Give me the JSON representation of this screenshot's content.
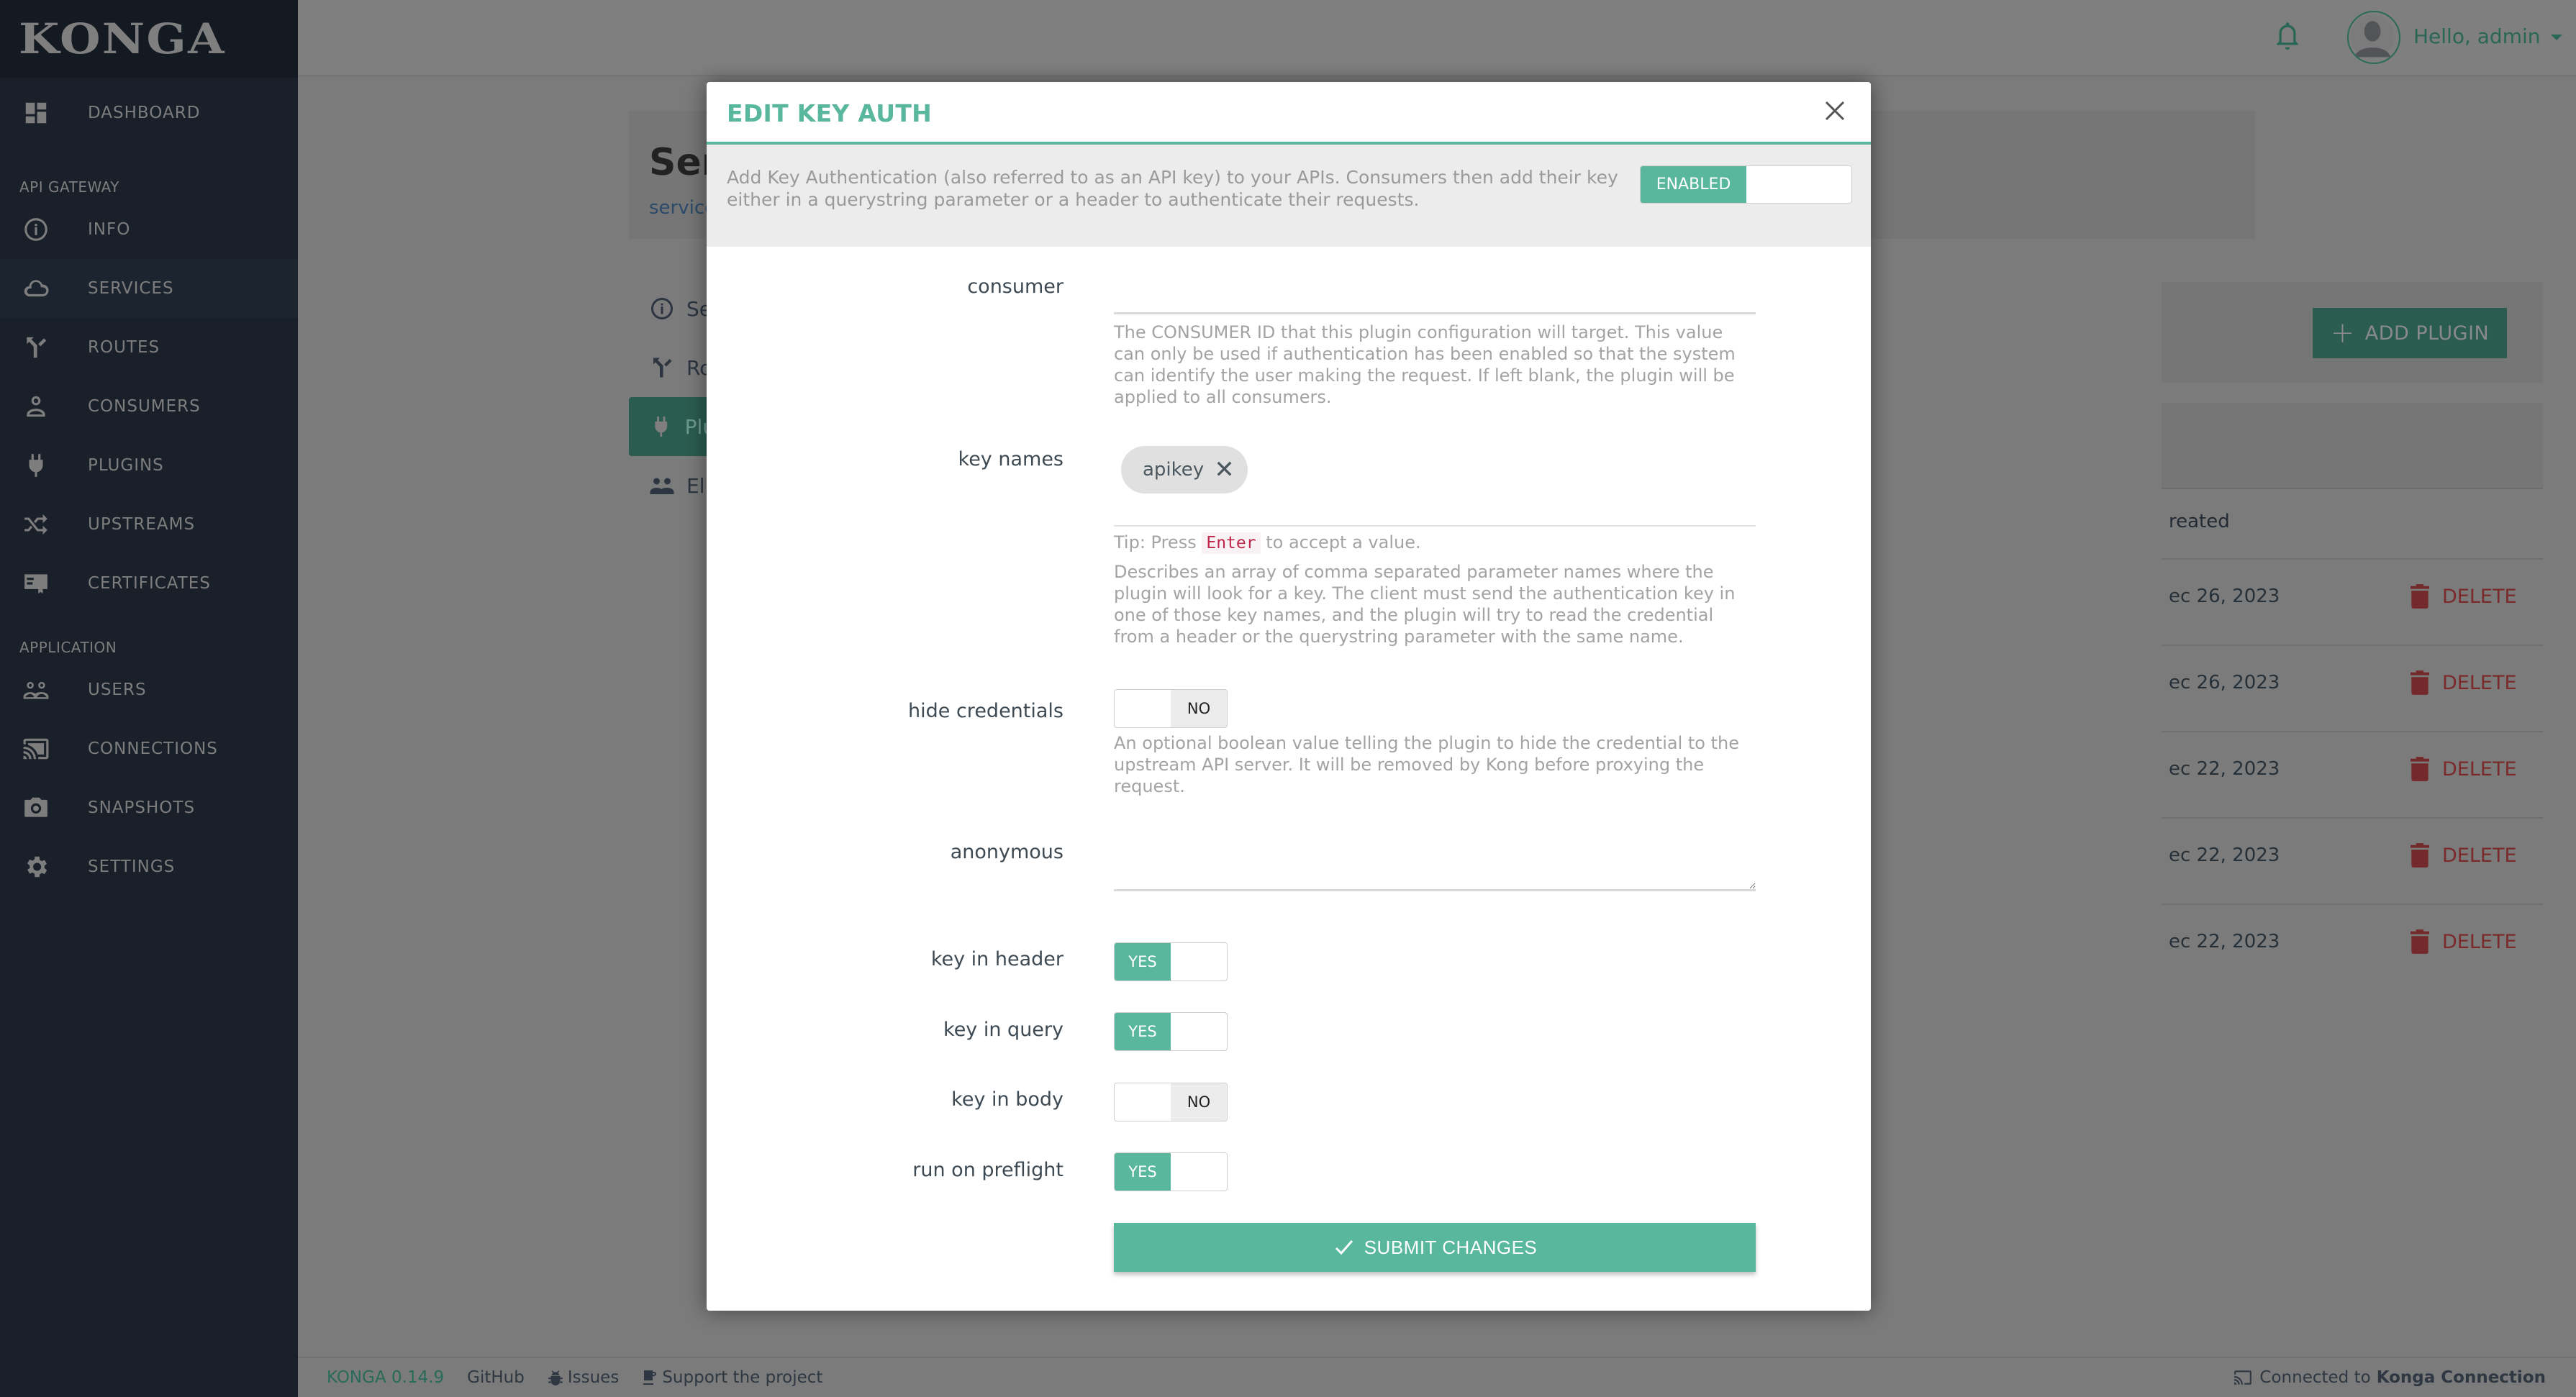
{
  "sidebar": {
    "brand": "KONGA",
    "items": [
      {
        "label": "DASHBOARD",
        "icon": "dashboard-icon"
      },
      {
        "section": "API GATEWAY"
      },
      {
        "label": "INFO",
        "icon": "info-icon"
      },
      {
        "label": "SERVICES",
        "icon": "cloud-icon",
        "active": true
      },
      {
        "label": "ROUTES",
        "icon": "routes-icon"
      },
      {
        "label": "CONSUMERS",
        "icon": "user-icon"
      },
      {
        "label": "PLUGINS",
        "icon": "plug-icon"
      },
      {
        "label": "UPSTREAMS",
        "icon": "shuffle-icon"
      },
      {
        "label": "CERTIFICATES",
        "icon": "certificate-icon"
      },
      {
        "section": "APPLICATION"
      },
      {
        "label": "USERS",
        "icon": "users-icon"
      },
      {
        "label": "CONNECTIONS",
        "icon": "cast-icon"
      },
      {
        "label": "SNAPSHOTS",
        "icon": "camera-icon"
      },
      {
        "label": "SETTINGS",
        "icon": "gear-icon"
      }
    ],
    "labels": {
      "dashboard": "DASHBOARD",
      "api_gateway": "API GATEWAY",
      "info": "INFO",
      "services": "SERVICES",
      "routes": "ROUTES",
      "consumers": "CONSUMERS",
      "plugins": "PLUGINS",
      "upstreams": "UPSTREAMS",
      "certificates": "CERTIFICATES",
      "application": "APPLICATION",
      "users": "USERS",
      "connections": "CONNECTIONS",
      "snapshots": "SNAPSHOTS",
      "settings": "SETTINGS"
    }
  },
  "topbar": {
    "greeting": "Hello, admin"
  },
  "page": {
    "title_partial": "Ser",
    "breadcrumb_partial": "service",
    "tabs": {
      "service_details": "Se",
      "routes": "Ro",
      "plugins": "Plu",
      "eligible_consumers": "Eli"
    },
    "add_plugin_label": "ADD PLUGIN",
    "column_header_partial": "reated",
    "rows": [
      {
        "created": "ec 26, 2023",
        "delete_label": "DELETE"
      },
      {
        "created": "ec 26, 2023",
        "delete_label": "DELETE"
      },
      {
        "created": "ec 22, 2023",
        "delete_label": "DELETE"
      },
      {
        "created": "ec 22, 2023",
        "delete_label": "DELETE"
      },
      {
        "created": "ec 22, 2023",
        "delete_label": "DELETE"
      }
    ]
  },
  "modal": {
    "title": "EDIT KEY AUTH",
    "description": "Add Key Authentication (also referred to as an API key) to your APIs. Consumers then add their key either in a querystring parameter or a header to authenticate their requests.",
    "enabled_label": "ENABLED",
    "enabled": true,
    "fields": {
      "consumer": {
        "label": "consumer",
        "value": "",
        "help": "The CONSUMER ID that this plugin configuration will target. This value can only be used if authentication has been enabled so that the system can identify the user making the request. If left blank, the plugin will be applied to all consumers."
      },
      "key_names": {
        "label": "key names",
        "values": [
          "apikey"
        ],
        "tip_prefix": "Tip: Press",
        "tip_key": "Enter",
        "tip_suffix": "to accept a value.",
        "help": "Describes an array of comma separated parameter names where the plugin will look for a key. The client must send the authentication key in one of those key names, and the plugin will try to read the credential from a header or the querystring parameter with the same name."
      },
      "hide_credentials": {
        "label": "hide credentials",
        "value": false,
        "state_label": "NO",
        "help": "An optional boolean value telling the plugin to hide the credential to the upstream API server. It will be removed by Kong before proxying the request."
      },
      "anonymous": {
        "label": "anonymous",
        "value": ""
      },
      "key_in_header": {
        "label": "key in header",
        "value": true,
        "state_label": "YES"
      },
      "key_in_query": {
        "label": "key in query",
        "value": true,
        "state_label": "YES"
      },
      "key_in_body": {
        "label": "key in body",
        "value": false,
        "state_label": "NO"
      },
      "run_on_preflight": {
        "label": "run on preflight",
        "value": true,
        "state_label": "YES"
      }
    },
    "submit_label": "SUBMIT CHANGES"
  },
  "footer": {
    "version": "KONGA 0.14.9",
    "github": "GitHub",
    "issues": "Issues",
    "support": "Support the project",
    "connected_prefix": "Connected to",
    "connection_name": "Konga Connection"
  },
  "colors": {
    "accent": "#58b79c",
    "sidebar_bg": "#19202a",
    "danger": "#d9534f"
  }
}
